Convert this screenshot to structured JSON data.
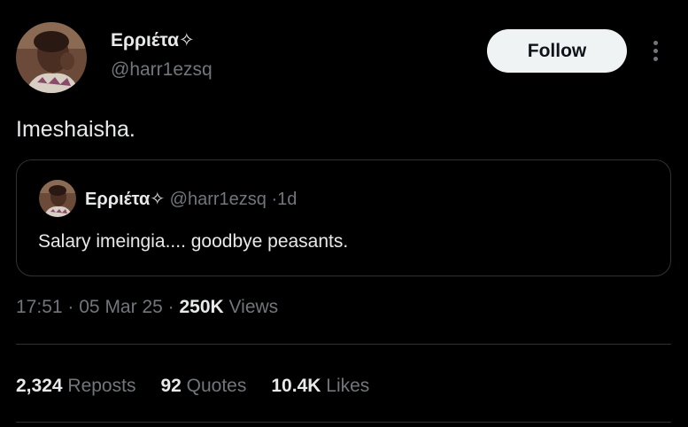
{
  "author": {
    "name": "Ερριέτα✧",
    "handle": "@harr1ezsq"
  },
  "follow_label": "Follow",
  "tweet": {
    "text": "Imeshaisha."
  },
  "quoted": {
    "name": "Ερριέτα✧",
    "handle": "@harr1ezsq",
    "separator": "·",
    "age": "1d",
    "text": "Salary imeingia.... goodbye peasants."
  },
  "meta": {
    "time": "17:51",
    "date": "05 Mar 25",
    "separator": "·",
    "views_count": "250K",
    "views_label": "Views"
  },
  "stats": {
    "reposts_count": "2,324",
    "reposts_label": "Reposts",
    "quotes_count": "92",
    "quotes_label": "Quotes",
    "likes_count": "10.4K",
    "likes_label": "Likes"
  },
  "colors": {
    "background": "#000000",
    "primary_text": "#e7e9ea",
    "secondary_text": "#71767b",
    "border": "#2f3336",
    "follow_bg": "#eff3f4"
  },
  "icons": {
    "more": "more-vertical-icon"
  }
}
